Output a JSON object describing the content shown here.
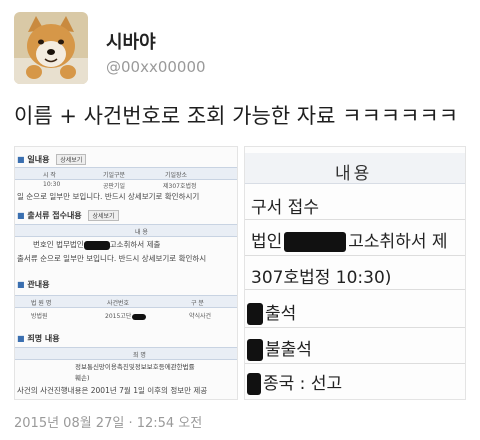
{
  "tweet": {
    "username": "시바야",
    "handle": "@00xx00000",
    "text": "이름 + 사건번호로 조회 가능한 자료 ㅋㅋㅋㅋㅋㅋ",
    "timestamp": "2015년 08월 27일 · 12:54 오전"
  },
  "left_doc": {
    "section1_title": "일내용",
    "detail_button": "상세보기",
    "table1_headers": [
      "시 작",
      "기일구분",
      "기일장소"
    ],
    "table1_row": [
      "10:30",
      "공판기일",
      "제307호법정"
    ],
    "table1_note": "일 순으로 일부만 보입니다. 반드시 상세보기로 확인하시기",
    "section2_title": "출서류 접수내용",
    "table2_header": "내 용",
    "table2_row_prefix": "번호인 법무법인",
    "table2_row_suffix": "고소취하서 제출",
    "table2_note": "출서류 순으로 일부만 보입니다. 반드시 상세보기로 확인하시",
    "section3_title": "관내용",
    "table3_headers": [
      "법 원 명",
      "사건번호",
      "구 분"
    ],
    "table3_row": [
      "방법원",
      "2015고단",
      "약식사건"
    ],
    "section4_title": "죄명 내용",
    "table4_header": "죄 명",
    "table4_row": "정보통신망이용촉진및정보보호등에관한법률",
    "table4_row2": "훼손)",
    "footer_note": "사건의 사건진행내용은 2001년 7월 1일 이후의 정보만 제공"
  },
  "right_doc": {
    "header": "내용",
    "line1": "구서 접수",
    "line2_prefix": "법인",
    "line2_suffix": "고소취하서 제",
    "line3": "307호법정 10:30)",
    "line4": "출석",
    "line5": "불출석",
    "line6": "종국 : 선고"
  },
  "colors": {
    "handle_gray": "#9a9a9a",
    "table_header_bg": "#e9eef5",
    "section_dot": "#3a6fb0"
  }
}
